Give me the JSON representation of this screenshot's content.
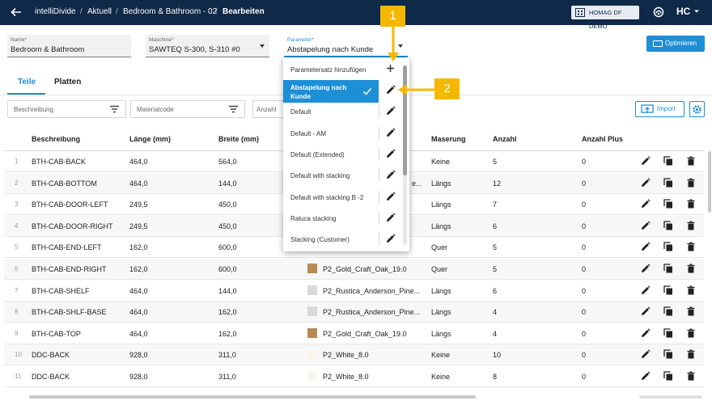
{
  "header": {
    "app_name": "intelliDivide",
    "breadcrumbs": [
      "Aktuell",
      "Bedroom & Bathroom - 02",
      "Bearbeiten"
    ],
    "separator": "/",
    "tenant": "HOMAG DF DEMO",
    "logo_text": "HC"
  },
  "form": {
    "name": {
      "label": "Name*",
      "value": "Bedroom & Bathroom"
    },
    "machine": {
      "label": "Maschine*",
      "value": "SAWTEQ S-300, S-310 #0"
    },
    "parameter": {
      "label": "Parameter*",
      "value": "Abstapelung nach Kunde"
    },
    "optimize_label": "Optimieren"
  },
  "tabs": [
    {
      "label": "Teile",
      "selected": true
    },
    {
      "label": "Platten",
      "selected": false
    }
  ],
  "filters": {
    "description": "Beschreibung",
    "material": "Materialcode",
    "quantity": "Anzahl",
    "import_label": "Import"
  },
  "table": {
    "columns": [
      "Beschreibung",
      "Länge (mm)",
      "Breite (mm)",
      "Maserung",
      "Anzahl",
      "Anzahl Plus"
    ],
    "rows": [
      {
        "idx": "1",
        "desc": "BTH-CAB-BACK",
        "len": "464,0",
        "wid": "564,0",
        "mat": "",
        "grain": "Keine",
        "qty": "5",
        "plus": "0"
      },
      {
        "idx": "2",
        "desc": "BTH-CAB-BOTTOM",
        "len": "464,0",
        "wid": "144,0",
        "mat": "e...",
        "grain": "Längs",
        "qty": "12",
        "plus": "0"
      },
      {
        "idx": "3",
        "desc": "BTH-CAB-DOOR-LEFT",
        "len": "249,5",
        "wid": "450,0",
        "mat": "",
        "grain": "Längs",
        "qty": "7",
        "plus": "0"
      },
      {
        "idx": "4",
        "desc": "BTH-CAB-DOOR-RIGHT",
        "len": "249,5",
        "wid": "450,0",
        "mat": "",
        "grain": "Längs",
        "qty": "6",
        "plus": "0"
      },
      {
        "idx": "5",
        "desc": "BTH-CAB-END-LEFT",
        "len": "162,0",
        "wid": "600,0",
        "mat": "",
        "grain": "Quer",
        "qty": "5",
        "plus": "0"
      },
      {
        "idx": "6",
        "desc": "BTH-CAB-END-RIGHT",
        "len": "162,0",
        "wid": "600,0",
        "mat": "P2_Gold_Craft_Oak_19.0",
        "grain": "Quer",
        "qty": "5",
        "plus": "0"
      },
      {
        "idx": "7",
        "desc": "BTH-CAB-SHELF",
        "len": "464,0",
        "wid": "144,0",
        "mat": "P2_Rustica_Anderson_Pine...",
        "grain": "Längs",
        "qty": "6",
        "plus": "0"
      },
      {
        "idx": "8",
        "desc": "BTH-CAB-SHLF-BASE",
        "len": "464,0",
        "wid": "162,0",
        "mat": "P2_Rustica_Anderson_Pine...",
        "grain": "Längs",
        "qty": "4",
        "plus": "0"
      },
      {
        "idx": "9",
        "desc": "BTH-CAB-TOP",
        "len": "464,0",
        "wid": "162,0",
        "mat": "P2_Gold_Craft_Oak_19.0",
        "grain": "Längs",
        "qty": "4",
        "plus": "0"
      },
      {
        "idx": "10",
        "desc": "DDC-BACK",
        "len": "928,0",
        "wid": "311,0",
        "mat": "P2_White_8.0",
        "grain": "Keine",
        "qty": "10",
        "plus": "0"
      },
      {
        "idx": "11",
        "desc": "DDC-BACK",
        "len": "928,0",
        "wid": "311,0",
        "mat": "P2_White_8.0",
        "grain": "Keine",
        "qty": "8",
        "plus": "0"
      }
    ]
  },
  "dropdown": {
    "add_label": "Parametersatz hinzufügen",
    "items": [
      {
        "label": "Abstapelung nach Kunde",
        "selected": true
      },
      {
        "label": "Default",
        "selected": false
      },
      {
        "label": "Default - AM",
        "selected": false
      },
      {
        "label": "Default (Extended)",
        "selected": false
      },
      {
        "label": "Default with stacking",
        "selected": false
      },
      {
        "label": "Default with stacking B -2",
        "selected": false
      },
      {
        "label": "Raluca stacking",
        "selected": false
      },
      {
        "label": "Stacking (Customer)",
        "selected": false
      }
    ]
  },
  "callouts": [
    "1",
    "2"
  ],
  "colors": {
    "topbar": "#0f2948",
    "accent": "#1d8fd6",
    "callout": "#f5b800"
  }
}
